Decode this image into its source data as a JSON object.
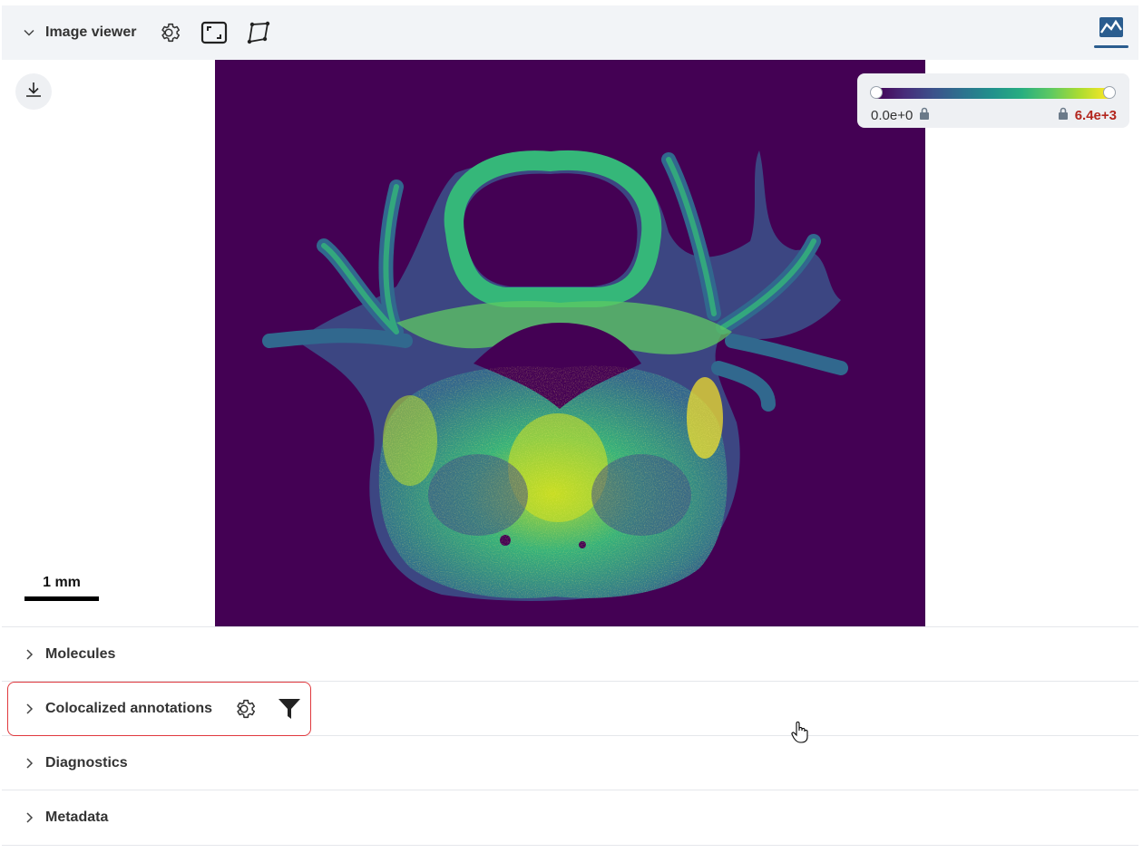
{
  "header": {
    "title": "Image viewer",
    "icons": [
      "chevron-down-icon",
      "gear-icon",
      "fit-screen-icon",
      "polygon-icon",
      "intensity-chart-icon"
    ]
  },
  "viewer": {
    "scale_label": "1 mm",
    "colorbar": {
      "min_label": "0.0e+0",
      "max_label": "6.4e+3",
      "max_color": "#b3261e",
      "colormap": "viridis"
    }
  },
  "sections": [
    {
      "label": "Molecules"
    },
    {
      "label": "Colocalized annotations"
    },
    {
      "label": "Diagnostics"
    },
    {
      "label": "Metadata"
    }
  ],
  "colors": {
    "header_bg": "#f2f4f7",
    "highlight_border": "#e0393e",
    "image_bg": "#440154"
  }
}
